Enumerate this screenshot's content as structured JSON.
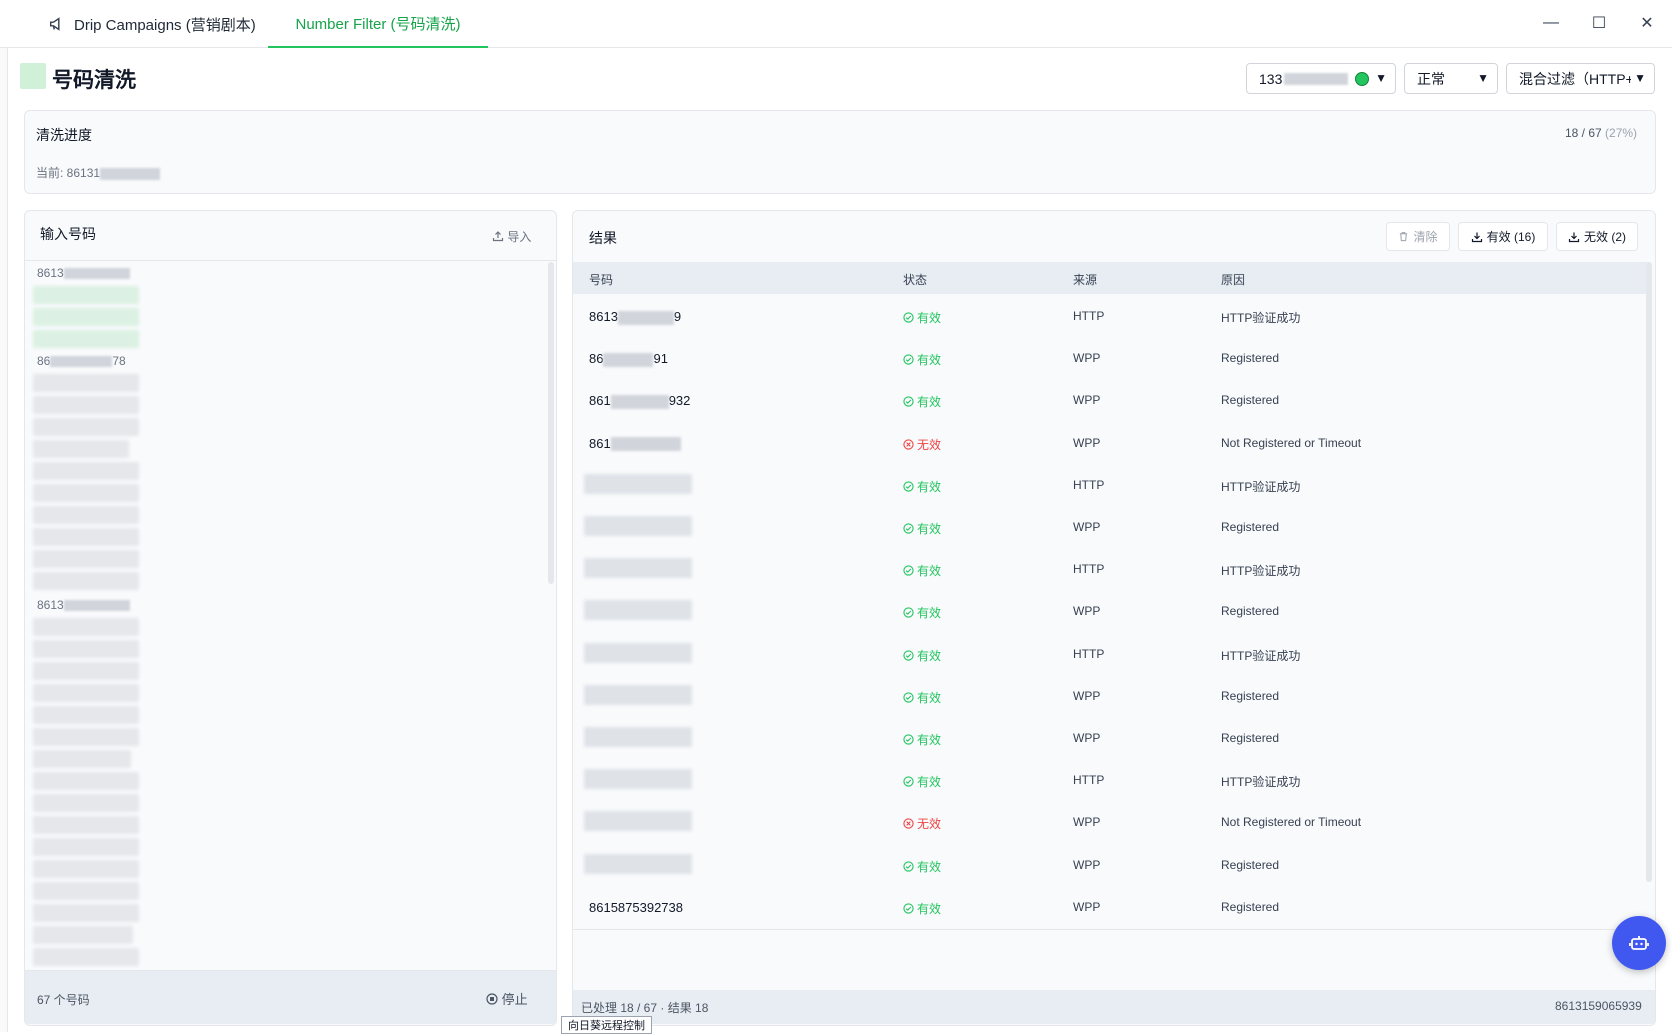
{
  "window": {
    "tabs": [
      {
        "label": "Drip Campaigns (营销剧本)",
        "active": false
      },
      {
        "label": "Number Filter (号码清洗)",
        "active": true
      }
    ],
    "controls": {
      "minimize": "—",
      "maximize": "☐",
      "close": "✕"
    }
  },
  "header": {
    "title": "号码清洗",
    "account_select": {
      "value": "133",
      "status_color": "#22c55e"
    },
    "mode_select": {
      "value": "正常"
    },
    "filter_select": {
      "value": "混合过滤（HTTP+"
    }
  },
  "progress": {
    "title": "清洗进度",
    "count": "18 / 67",
    "percent": "(27%)",
    "current_label": "当前: 86131"
  },
  "input_panel": {
    "title": "输入号码",
    "import_label": "导入",
    "visible_numbers": [
      "8613",
      "86",
      "78",
      "8613"
    ],
    "count_label": "67 个号码",
    "stop_label": "停止"
  },
  "results": {
    "title": "结果",
    "buttons": {
      "clear": "清除",
      "valid": "有效 (16)",
      "invalid": "无效 (2)"
    },
    "columns": [
      "号码",
      "状态",
      "来源",
      "原因"
    ],
    "rows": [
      {
        "number_prefix": "8613",
        "number_suffix": "9",
        "status": "有效",
        "valid": true,
        "source": "HTTP",
        "reason": "HTTP验证成功"
      },
      {
        "number_prefix": "86",
        "number_suffix": "91",
        "status": "有效",
        "valid": true,
        "source": "WPP",
        "reason": "Registered"
      },
      {
        "number_prefix": "861",
        "number_suffix": "932",
        "status": "有效",
        "valid": true,
        "source": "WPP",
        "reason": "Registered"
      },
      {
        "number_prefix": "861",
        "number_suffix": "",
        "status": "无效",
        "valid": false,
        "source": "WPP",
        "reason": "Not Registered or Timeout"
      },
      {
        "number_prefix": "",
        "number_suffix": "",
        "status": "有效",
        "valid": true,
        "source": "HTTP",
        "reason": "HTTP验证成功"
      },
      {
        "number_prefix": "",
        "number_suffix": "",
        "status": "有效",
        "valid": true,
        "source": "WPP",
        "reason": "Registered"
      },
      {
        "number_prefix": "",
        "number_suffix": "",
        "status": "有效",
        "valid": true,
        "source": "HTTP",
        "reason": "HTTP验证成功"
      },
      {
        "number_prefix": "",
        "number_suffix": "",
        "status": "有效",
        "valid": true,
        "source": "WPP",
        "reason": "Registered"
      },
      {
        "number_prefix": "",
        "number_suffix": "",
        "status": "有效",
        "valid": true,
        "source": "HTTP",
        "reason": "HTTP验证成功"
      },
      {
        "number_prefix": "",
        "number_suffix": "",
        "status": "有效",
        "valid": true,
        "source": "WPP",
        "reason": "Registered"
      },
      {
        "number_prefix": "",
        "number_suffix": "",
        "status": "有效",
        "valid": true,
        "source": "WPP",
        "reason": "Registered"
      },
      {
        "number_prefix": "",
        "number_suffix": "",
        "status": "有效",
        "valid": true,
        "source": "HTTP",
        "reason": "HTTP验证成功"
      },
      {
        "number_prefix": "",
        "number_suffix": "",
        "status": "无效",
        "valid": false,
        "source": "WPP",
        "reason": "Not Registered or Timeout"
      },
      {
        "number_prefix": "",
        "number_suffix": "",
        "status": "有效",
        "valid": true,
        "source": "WPP",
        "reason": "Registered"
      },
      {
        "number_prefix": "8615875392738",
        "number_suffix": "",
        "status": "有效",
        "valid": true,
        "source": "WPP",
        "reason": "Registered"
      }
    ],
    "footer_left": "已处理 18 / 67 · 结果 18",
    "footer_right": "8613159065939"
  },
  "tooltip": "向日葵远程控制",
  "colors": {
    "accent": "#22c55e",
    "invalid": "#ef4444",
    "fab": "#4158f0"
  }
}
